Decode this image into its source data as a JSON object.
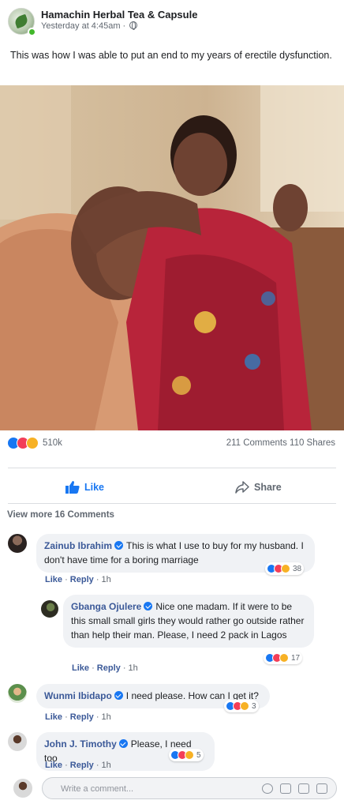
{
  "post": {
    "page_name": "Hamachin Herbal Tea & Capsule",
    "timestamp": "Yesterday at 4:45am · ",
    "text": "This was how I was able to put an end to my years of erectile dysfunction.",
    "photo_icon": "couple-hugging-photo"
  },
  "stats": {
    "reactions": "510k",
    "comments_shares": "211 Comments 110 Shares"
  },
  "actions": {
    "like_label": "Like",
    "share_label": "Share"
  },
  "view_more": "View more 16 Comments",
  "comments": [
    {
      "author": "Zainub Ibrahim",
      "text": "This is what I use to buy for my husband. I don't have time for a boring marriage",
      "reaction_count": "38",
      "like": "Like",
      "reply": "Reply",
      "time": "1h"
    },
    {
      "author": "Gbanga Ojulere",
      "text": "Nice one madam. If it were to be this small small girls they would rather go outside rather than help their man. Please, I need 2 pack in Lagos",
      "reaction_count": "17",
      "like": "Like",
      "reply": "Reply",
      "time": "1h"
    },
    {
      "author": "Wunmi Ibidapo",
      "text": "I need please. How can I get it?",
      "reaction_count": "3",
      "like": "Like",
      "reply": "Reply",
      "time": "1h"
    },
    {
      "author": "John J. Timothy",
      "text": "Please, I need too",
      "reaction_count": "5",
      "like": "Like",
      "reply": "Reply",
      "time": "1h"
    }
  ],
  "composer": {
    "placeholder": "Write a comment..."
  },
  "colors": {
    "accent": "#1877f2",
    "author_link": "#3b5998",
    "bubble": "#f0f2f5"
  }
}
